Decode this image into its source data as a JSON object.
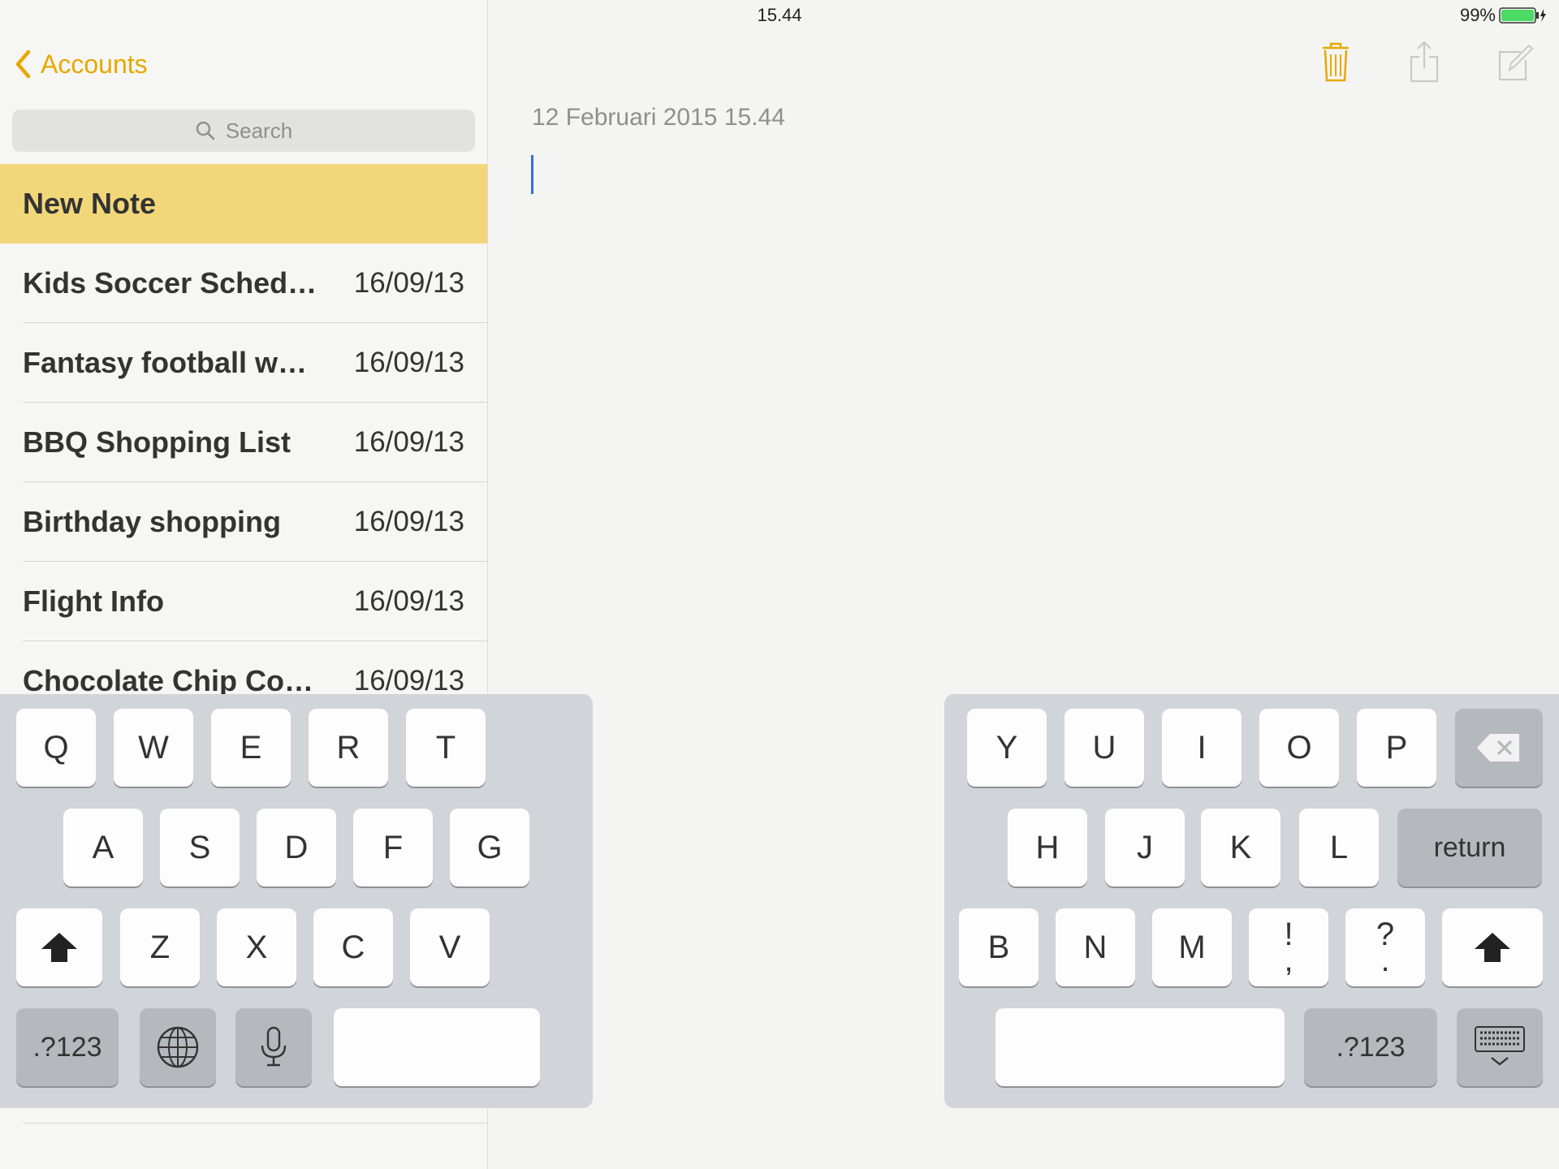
{
  "status": {
    "device": "iPad",
    "time": "15.44",
    "battery": "99%"
  },
  "sidebar": {
    "back_label": "Accounts",
    "search_placeholder": "Search",
    "notes": [
      {
        "title": "New Note",
        "date": ""
      },
      {
        "title": "Kids Soccer Sched…",
        "date": "16/09/13"
      },
      {
        "title": "Fantasy football w…",
        "date": "16/09/13"
      },
      {
        "title": "BBQ Shopping List",
        "date": "16/09/13"
      },
      {
        "title": "Birthday shopping",
        "date": "16/09/13"
      },
      {
        "title": "Flight Info",
        "date": "16/09/13"
      },
      {
        "title": "Chocolate Chip Co…",
        "date": "16/09/13"
      }
    ]
  },
  "editor": {
    "date": "12 Februari 2015 15.44"
  },
  "colors": {
    "accent": "#e6a800",
    "selected_note": "#f2d77a",
    "cursor": "#2f6ee3"
  },
  "keyboard": {
    "left": {
      "row1": [
        "Q",
        "W",
        "E",
        "R",
        "T"
      ],
      "row2": [
        "A",
        "S",
        "D",
        "F",
        "G"
      ],
      "row3": [
        "Z",
        "X",
        "C",
        "V"
      ],
      "numbers": ".?123"
    },
    "right": {
      "row1": [
        "Y",
        "U",
        "I",
        "O",
        "P"
      ],
      "row2": [
        "H",
        "J",
        "K",
        "L"
      ],
      "return": "return",
      "row3": [
        "B",
        "N",
        "M"
      ],
      "punct1_top": "!",
      "punct1_bottom": ",",
      "punct2_top": "?",
      "punct2_bottom": ".",
      "numbers": ".?123"
    }
  }
}
